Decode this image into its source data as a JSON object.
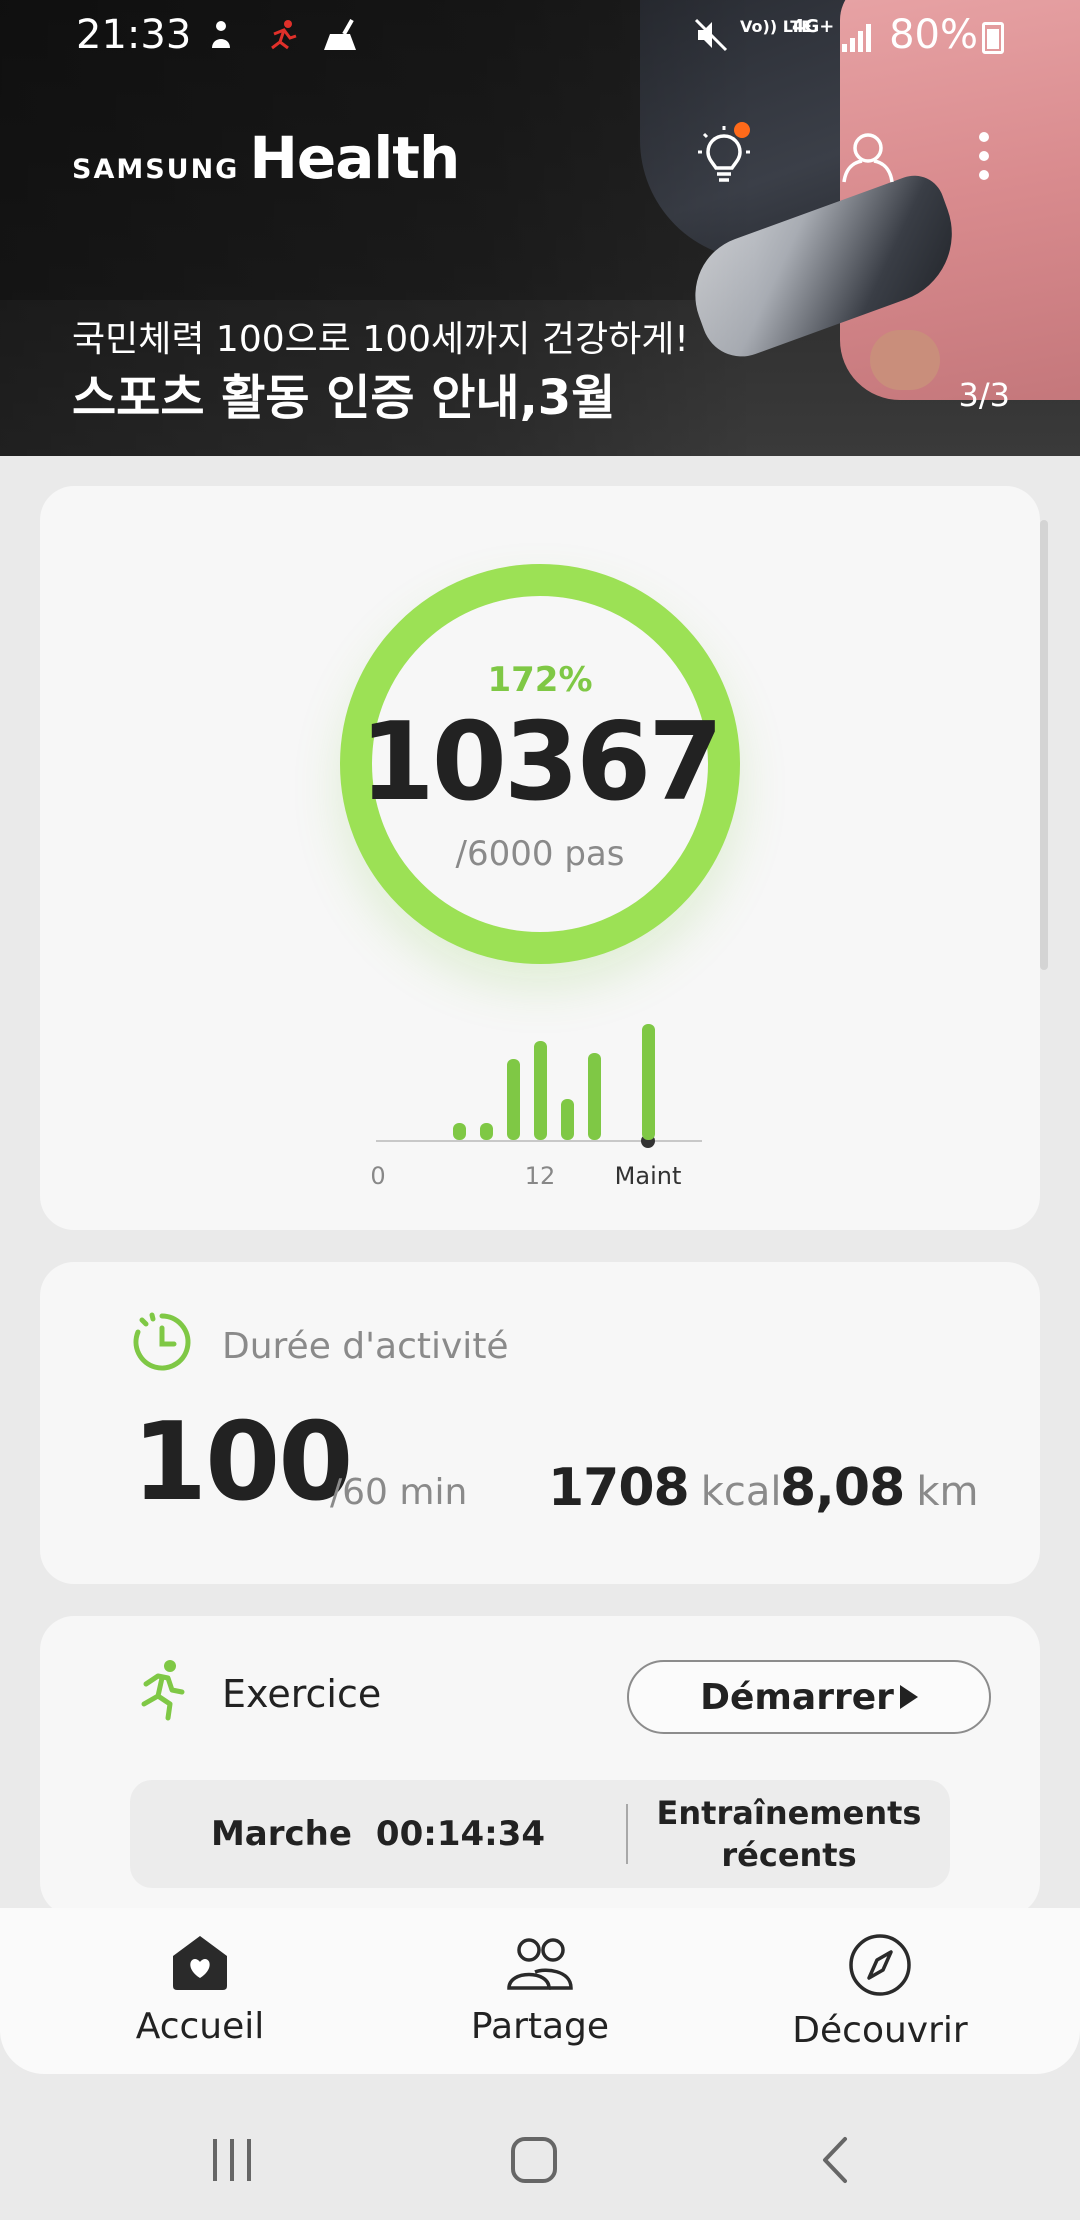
{
  "status_bar": {
    "time": "21:33",
    "lte_label": "Vo)) LTE",
    "net_label": "4G+",
    "battery": "80%"
  },
  "header": {
    "brand_samsung": "SAMSUNG",
    "brand_health": "Health",
    "icons": [
      "lightbulb-tips-icon",
      "profile-icon",
      "more-options-icon"
    ]
  },
  "promo": {
    "subtitle": "국민체력 100으로 100세까지 건강하게!",
    "title": "스포츠 활동 인증 안내,3월",
    "pager": "3/3"
  },
  "steps": {
    "percent": "172%",
    "count": "10367",
    "goal": "/6000 pas",
    "progress_fraction": 1.0,
    "timeline_labels": [
      "0",
      "12",
      "Maint"
    ],
    "hourly_bars": [
      {
        "hour": 6,
        "value": 0.15
      },
      {
        "hour": 8,
        "value": 0.15
      },
      {
        "hour": 10,
        "value": 0.7
      },
      {
        "hour": 12,
        "value": 0.85
      },
      {
        "hour": 14,
        "value": 0.35
      },
      {
        "hour": 16,
        "value": 0.75
      },
      {
        "hour": 20,
        "value": 1.0
      }
    ]
  },
  "activity": {
    "title": "Durée d'activité",
    "minutes": "100",
    "goal": "/60 min",
    "kcal_value": "1708",
    "kcal_unit": "kcal",
    "km_value": "8,08",
    "km_unit": "km"
  },
  "exercise": {
    "title": "Exercice",
    "start_label": "Démarrer",
    "last_type": "Marche",
    "last_duration": "00:14:34",
    "recent_label": "Entraînements récents"
  },
  "bottom_nav": {
    "home": "Accueil",
    "share": "Partage",
    "discover": "Découvrir"
  },
  "colors": {
    "accent_green": "#7fc845",
    "tip_dot": "#ff6a1a"
  }
}
